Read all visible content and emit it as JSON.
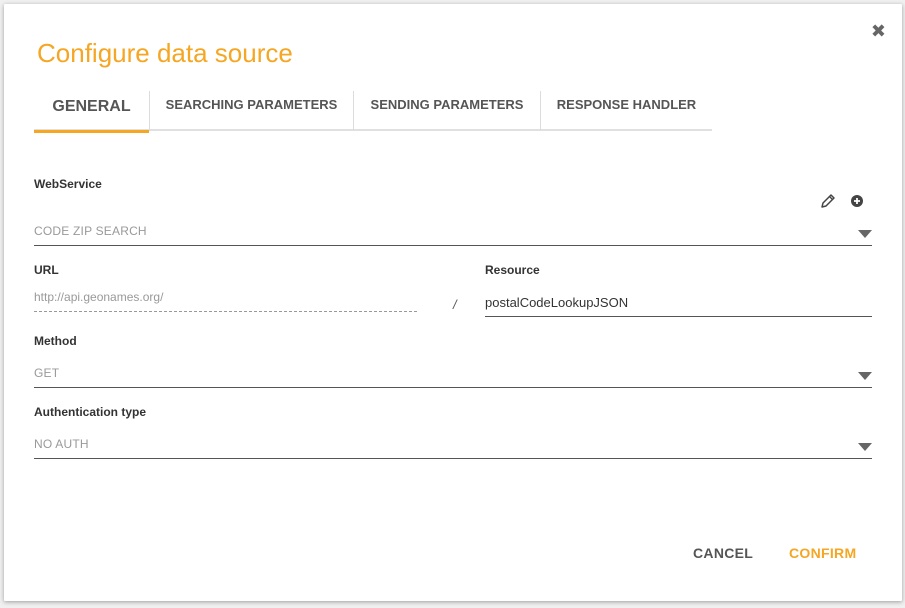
{
  "dialog": {
    "title": "Configure data source",
    "close_icon": "close-icon"
  },
  "tabs": [
    {
      "label": "GENERAL",
      "active": true
    },
    {
      "label": "SEARCHING PARAMETERS",
      "active": false
    },
    {
      "label": "SENDING PARAMETERS",
      "active": false
    },
    {
      "label": "RESPONSE HANDLER",
      "active": false
    }
  ],
  "form": {
    "webservice": {
      "label": "WebService",
      "value": "CODE ZIP SEARCH"
    },
    "url": {
      "label": "URL",
      "placeholder": "http://api.geonames.org/"
    },
    "separator": "/",
    "resource": {
      "label": "Resource",
      "value": "postalCodeLookupJSON"
    },
    "method": {
      "label": "Method",
      "value": "GET"
    },
    "auth": {
      "label": "Authentication type",
      "value": "NO AUTH"
    }
  },
  "icons": {
    "edit": "pencil-icon",
    "add": "plus-circle-icon"
  },
  "actions": {
    "cancel": "CANCEL",
    "confirm": "CONFIRM"
  },
  "colors": {
    "accent": "#f5a623",
    "text": "#333333",
    "muted": "#999999"
  }
}
